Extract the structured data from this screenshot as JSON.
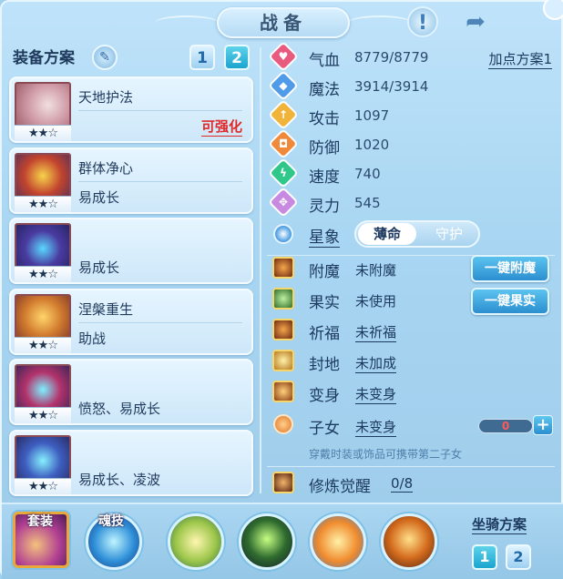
{
  "title": "战备",
  "icons": {
    "info": "info-icon",
    "share": "share-icon",
    "edit": "pencil-icon"
  },
  "equip_plan": {
    "label": "装备方案",
    "tabs": [
      "1",
      "2"
    ],
    "active_tab": 2
  },
  "equipment": [
    {
      "name": "天地护法",
      "tag": "",
      "status": "可强化",
      "stars": "★★☆"
    },
    {
      "name": "群体净心",
      "tag": "易成长",
      "status": "",
      "stars": "★★☆"
    },
    {
      "name": "",
      "tag": "易成长",
      "status": "",
      "stars": "★★☆"
    },
    {
      "name": "涅槃重生",
      "tag": "助战",
      "status": "",
      "stars": "★★☆"
    },
    {
      "name": "",
      "tag": "愤怒、易成长",
      "status": "",
      "stars": "★★☆"
    },
    {
      "name": "",
      "tag": "易成长、凌波",
      "status": "",
      "stars": "★★☆"
    }
  ],
  "attributes": [
    {
      "key": "气血",
      "value": "8779/8779",
      "color": "#e85a7e",
      "glyph": "♥"
    },
    {
      "key": "魔法",
      "value": "3914/3914",
      "color": "#4f9be8",
      "glyph": "◆"
    },
    {
      "key": "攻击",
      "value": "1097",
      "color": "#f0b43a",
      "glyph": "↑"
    },
    {
      "key": "防御",
      "value": "1020",
      "color": "#f08a3a",
      "glyph": "◘"
    },
    {
      "key": "速度",
      "value": "740",
      "color": "#2fc78a",
      "glyph": "ϟ"
    },
    {
      "key": "灵力",
      "value": "545",
      "color": "#c78ae0",
      "glyph": "✥"
    }
  ],
  "point_plan": "加点方案1",
  "star_sign": {
    "label": "星象",
    "options": [
      "薄命",
      "守护"
    ],
    "selected": "薄命"
  },
  "special": [
    {
      "key": "附魔",
      "value": "未附魔",
      "underline": false
    },
    {
      "key": "果实",
      "value": "未使用",
      "underline": false
    },
    {
      "key": "祈福",
      "value": "未祈福",
      "underline": true
    },
    {
      "key": "封地",
      "value": "未加成",
      "underline": true
    },
    {
      "key": "变身",
      "value": "未变身",
      "underline": true
    }
  ],
  "buttons": {
    "enchant_all": "一键附魔",
    "fruit_all": "一键果实"
  },
  "child": {
    "key": "子女",
    "value": "未变身",
    "count": "0",
    "plus": "+"
  },
  "child_note": "穿戴时装或饰品可携带第二子女",
  "cultivation": {
    "key": "修炼觉醒",
    "value": "0/8"
  },
  "bottom": {
    "labels": {
      "outfit": "套装",
      "soul_skill": "魂技"
    },
    "mount_plan": "坐骑方案",
    "mount_tabs": [
      "1",
      "2"
    ],
    "active_mount_tab": 1
  }
}
